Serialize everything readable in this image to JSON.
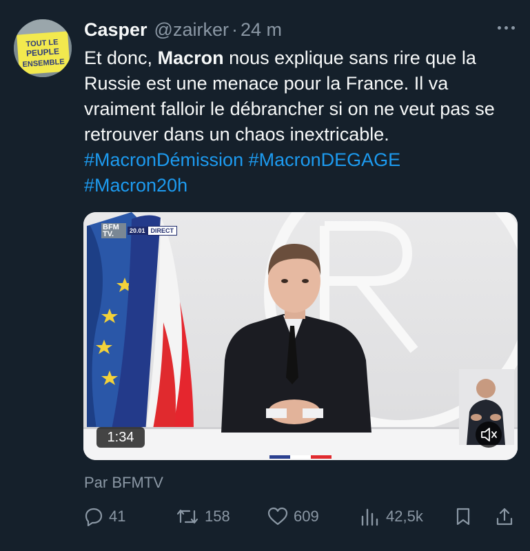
{
  "author": {
    "display_name": "Casper",
    "handle": "@zairker",
    "separator": "·",
    "time": "24 m",
    "avatar_text": [
      "TOUT LE",
      "PEUPLE",
      "ENSEMBLE"
    ]
  },
  "tweet": {
    "text_prefix": "Et donc, ",
    "text_bold": "Macron",
    "text_rest": " nous explique sans rire que la Russie est une menace pour la France. Il va vraiment falloir le débrancher si on ne veut pas se retrouver dans un chaos inextricable.",
    "hashtags": [
      "#MacronDémission",
      "#MacronDEGAGE",
      "#Macron20h"
    ]
  },
  "video": {
    "channel_logo": "BFM TV.",
    "clock": "20.01",
    "live_label": "DIRECT",
    "duration": "1:34",
    "attribution": "Par BFMTV"
  },
  "actions": {
    "replies": "41",
    "retweets": "158",
    "likes": "609",
    "views": "42,5k"
  },
  "icons": {
    "more": "more-icon",
    "reply": "reply-icon",
    "retweet": "retweet-icon",
    "like": "like-icon",
    "views": "views-icon",
    "bookmark": "bookmark-icon",
    "share": "share-icon",
    "mute": "volume-muted-icon"
  },
  "colors": {
    "background": "#15202b",
    "text": "#f7f9f9",
    "muted": "#8b98a5",
    "link": "#1d9bf0"
  }
}
